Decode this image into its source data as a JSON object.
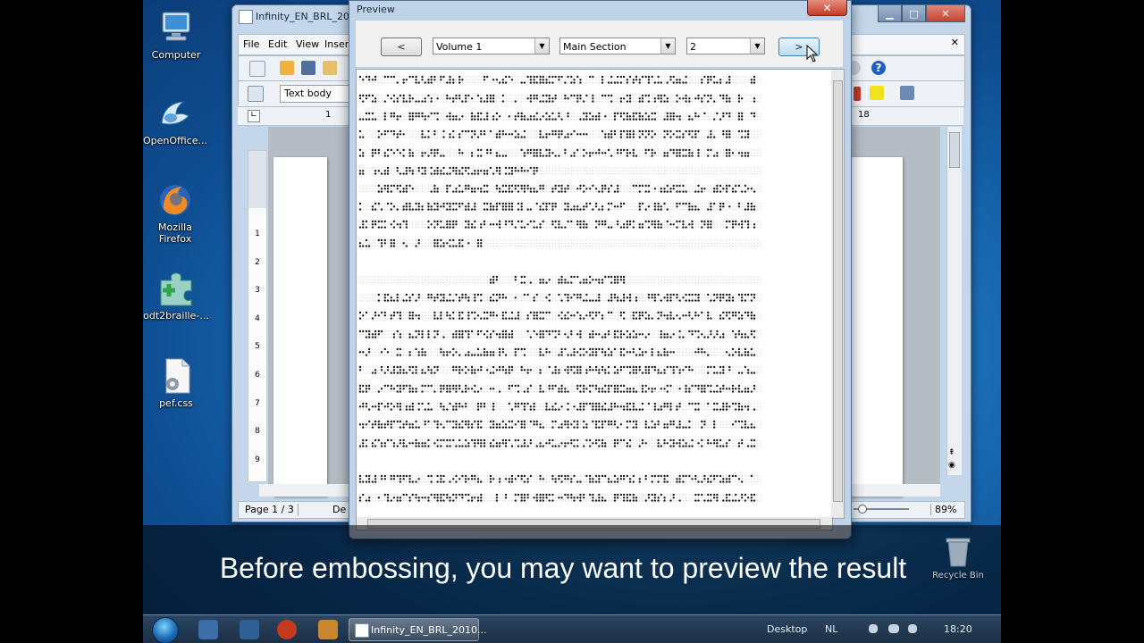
{
  "desktop": {
    "icons": [
      {
        "label": "Computer",
        "icon": "computer-icon"
      },
      {
        "label": "OpenOffice...",
        "icon": "openoffice-icon"
      },
      {
        "label": "Mozilla Firefox",
        "icon": "firefox-icon"
      },
      {
        "label": "odt2braille-...",
        "icon": "puzzle-icon"
      },
      {
        "label": "pef.css",
        "icon": "css-file-icon"
      }
    ],
    "recycle_bin_label": "Recycle Bin"
  },
  "writer": {
    "title": "Infinity_EN_BRL_2010...",
    "menu": [
      "File",
      "Edit",
      "View",
      "Insert"
    ],
    "paragraph_style": "Text body",
    "ruler_left_tick": "1",
    "ruler_right_tick": "18",
    "vertical_ruler_ticks": [
      "1",
      "2",
      "3",
      "4",
      "5",
      "6",
      "7",
      "8",
      "9"
    ],
    "status": {
      "page": "Page 1 / 3",
      "language": "De",
      "zoom": "89%"
    }
  },
  "preview": {
    "title": "Preview",
    "prev_button": "<",
    "next_button": ">",
    "volume": "Volume 1",
    "section": "Main Section",
    "page": "2"
  },
  "caption": "Before embossing, you may want to preview the result",
  "taskbar": {
    "task_label": "Infinity_EN_BRL_2010...",
    "desktop_label": "Desktop",
    "lang": "NL",
    "time": "18:20"
  },
  "colors": {
    "desktop_blue": "#1b6fb8",
    "window_frame": "#bfd3e8",
    "close_red": "#c5432f",
    "caption_band": "#000000"
  }
}
